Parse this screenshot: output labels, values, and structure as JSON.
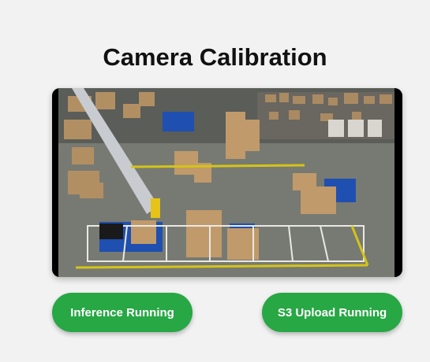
{
  "page": {
    "title": "Camera Calibration"
  },
  "camera_feed": {
    "icon": "camera-feed-image",
    "scene": "warehouse-floor"
  },
  "status_buttons": [
    {
      "label": "Inference Running",
      "color": "#28a745"
    },
    {
      "label": "S3 Upload Running",
      "color": "#28a745"
    }
  ],
  "colors": {
    "background": "#f2f2f2",
    "accent": "#28a745",
    "title": "#111111"
  }
}
